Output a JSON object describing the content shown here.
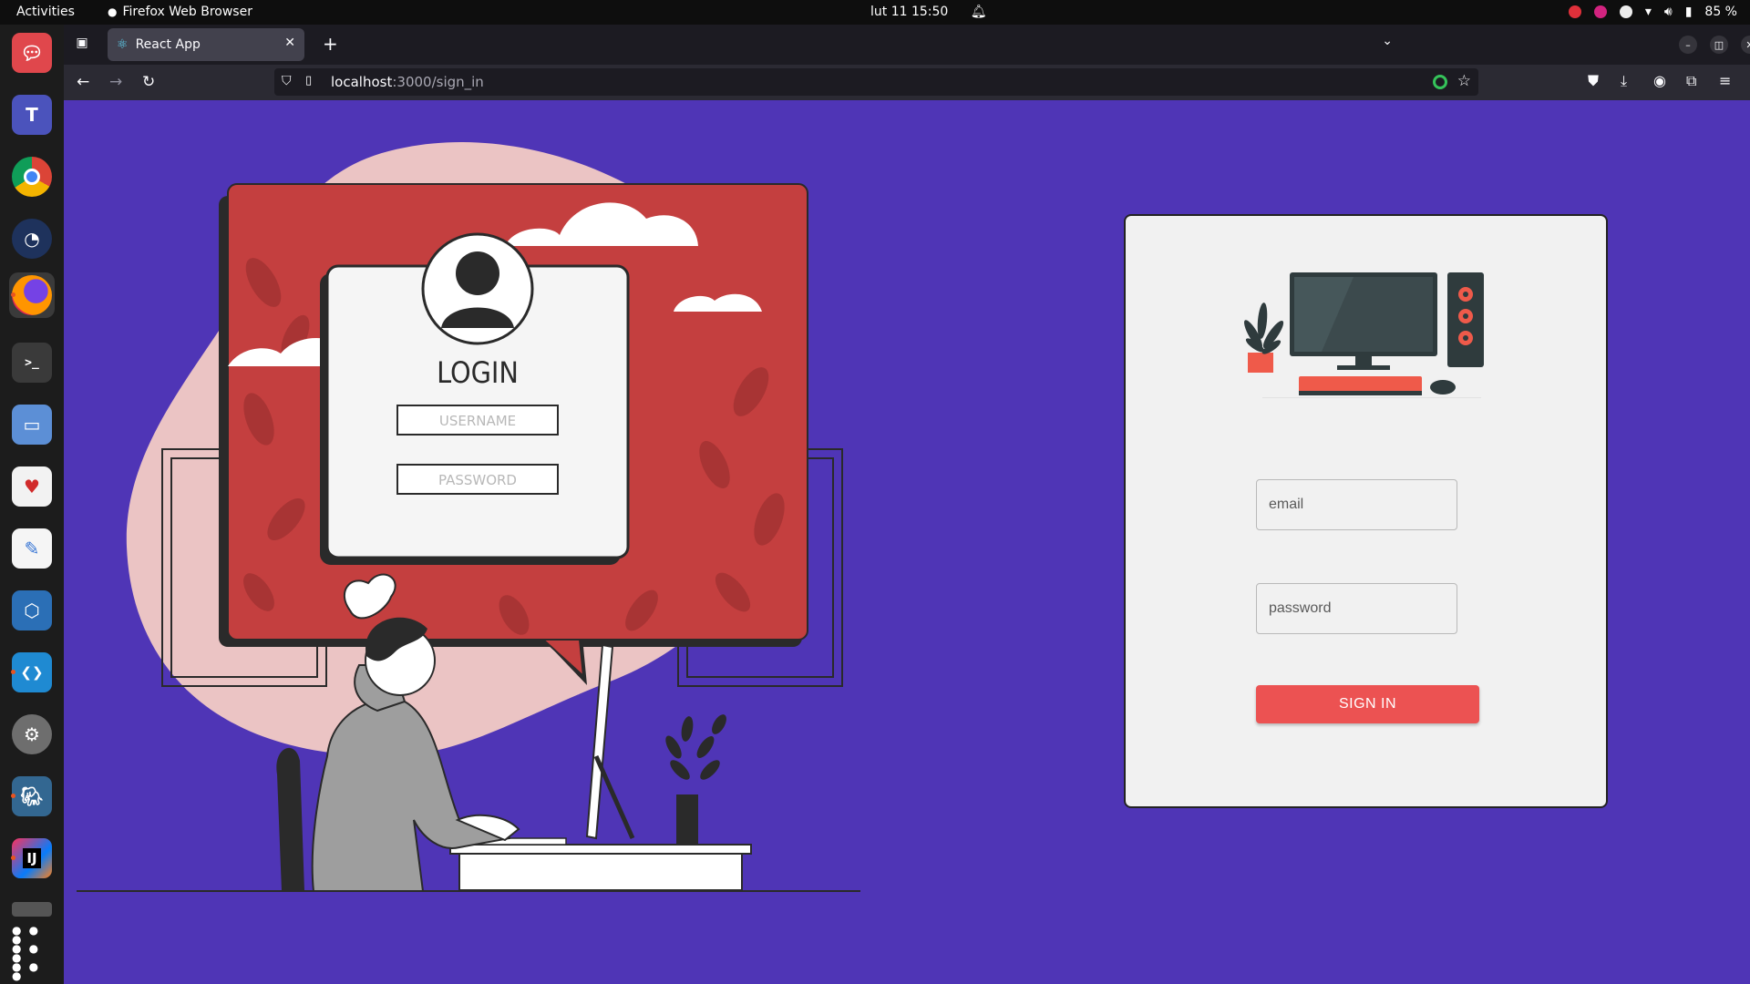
{
  "system_bar": {
    "activities": "Activities",
    "app_name": "Firefox Web Browser",
    "clock": "lut 11  15:50",
    "battery": "85 %"
  },
  "dock": {
    "items": [
      {
        "name": "rocketchat",
        "color": "#e0474c",
        "glyph": "💬"
      },
      {
        "name": "teams",
        "color": "#4b53bc",
        "glyph": "T"
      },
      {
        "name": "chrome",
        "color": "#2a7de1",
        "glyph": "◎"
      },
      {
        "name": "mattermost",
        "color": "#1e325c",
        "glyph": "◐"
      },
      {
        "name": "firefox",
        "color": "#e66000",
        "glyph": "◉"
      },
      {
        "name": "terminal",
        "color": "#3a3a3a",
        "glyph": ">_"
      },
      {
        "name": "files",
        "color": "#5c8fd6",
        "glyph": "▭"
      },
      {
        "name": "solitaire",
        "color": "#f2f2f2",
        "glyph": "♥"
      },
      {
        "name": "text-editor",
        "color": "#f5f5f5",
        "glyph": "✎"
      },
      {
        "name": "virtualbox",
        "color": "#2b6fb6",
        "glyph": "⬡"
      },
      {
        "name": "vscode",
        "color": "#1f8ad2",
        "glyph": "❮❯"
      },
      {
        "name": "settings",
        "color": "#6e6e6e",
        "glyph": "⚙"
      },
      {
        "name": "postgresql",
        "color": "#336791",
        "glyph": "🐘"
      },
      {
        "name": "intellij",
        "color": "#fe315d",
        "glyph": "IJ"
      },
      {
        "name": "drive",
        "color": "#555555",
        "glyph": "▬"
      },
      {
        "name": "show-apps",
        "color": "#1c1c1c",
        "glyph": "⋮⋮⋮"
      }
    ]
  },
  "browser": {
    "tab_title": "React App",
    "url_host": "localhost",
    "url_path": ":3000/sign_in"
  },
  "signin": {
    "email_placeholder": "email",
    "password_placeholder": "password",
    "button_label": "SIGN IN"
  },
  "illustration": {
    "login_title": "LOGIN",
    "username_label": "USERNAME",
    "password_label": "PASSWORD"
  },
  "colors": {
    "page_background": "#4f35b6",
    "card_background": "#f1f1f1",
    "button": "#ec5252",
    "illustration_red": "#c43f3f",
    "illustration_pink": "#ebc4c4"
  }
}
